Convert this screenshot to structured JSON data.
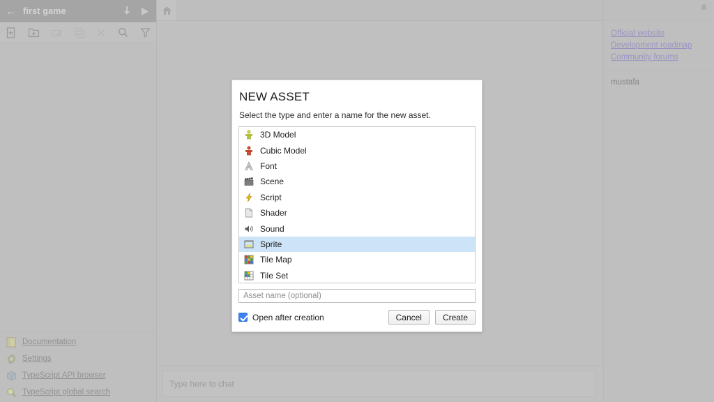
{
  "project": {
    "back_icon": "back-arrow-icon",
    "title": "first game",
    "download_icon": "download-icon",
    "run_icon": "play-icon"
  },
  "asset_toolbar": {
    "items": [
      {
        "name": "new-asset-button",
        "icon": "new-file-icon",
        "disabled": false
      },
      {
        "name": "new-folder-button",
        "icon": "new-folder-icon",
        "disabled": false
      },
      {
        "name": "rename-asset-button",
        "icon": "rename-icon",
        "disabled": true
      },
      {
        "name": "duplicate-asset-button",
        "icon": "duplicate-icon",
        "disabled": true
      },
      {
        "name": "delete-asset-button",
        "icon": "close-x-icon",
        "disabled": true
      },
      {
        "name": "search-assets-button",
        "icon": "search-icon",
        "disabled": false
      },
      {
        "name": "filter-assets-button",
        "icon": "filter-icon",
        "disabled": false
      }
    ]
  },
  "left_links": [
    {
      "label": "Documentation",
      "icon": "book-icon"
    },
    {
      "label": "Settings",
      "icon": "gear-icon"
    },
    {
      "label": "TypeScript API browser",
      "icon": "cube-icon"
    },
    {
      "label": "TypeScript global search",
      "icon": "magnifier-icon"
    }
  ],
  "tabs": [
    {
      "label": "",
      "icon": "home-icon",
      "active": true
    }
  ],
  "chat": {
    "placeholder": "Type here to chat",
    "value": ""
  },
  "right_panel": {
    "notification_icon": "bell-icon",
    "links": [
      "Official website",
      "Development roadmap",
      "Community forums"
    ],
    "users": [
      "mustafa"
    ]
  },
  "dialog": {
    "title": "NEW ASSET",
    "subtitle": "Select the type and enter a name for the new asset.",
    "asset_types": [
      {
        "label": "3D Model",
        "icon": "model-3d-icon",
        "selected": false
      },
      {
        "label": "Cubic Model",
        "icon": "cubic-model-icon",
        "selected": false
      },
      {
        "label": "Font",
        "icon": "font-icon",
        "selected": false
      },
      {
        "label": "Scene",
        "icon": "scene-clapper-icon",
        "selected": false
      },
      {
        "label": "Script",
        "icon": "script-lightning-icon",
        "selected": false
      },
      {
        "label": "Shader",
        "icon": "shader-page-icon",
        "selected": false
      },
      {
        "label": "Sound",
        "icon": "sound-speaker-icon",
        "selected": false
      },
      {
        "label": "Sprite",
        "icon": "sprite-image-icon",
        "selected": true
      },
      {
        "label": "Tile Map",
        "icon": "tile-map-icon",
        "selected": false
      },
      {
        "label": "Tile Set",
        "icon": "tile-set-icon",
        "selected": false
      }
    ],
    "name_input": {
      "value": "",
      "placeholder": "Asset name (optional)"
    },
    "open_after_creation": {
      "label": "Open after creation",
      "checked": true
    },
    "cancel_label": "Cancel",
    "create_label": "Create"
  },
  "colors": {
    "selection_blue": "#cde3f7",
    "checkbox_blue": "#3b82f6",
    "link_purple": "#6b62c8",
    "header_gray": "#888888",
    "panel_gray": "#c2c2c2"
  }
}
